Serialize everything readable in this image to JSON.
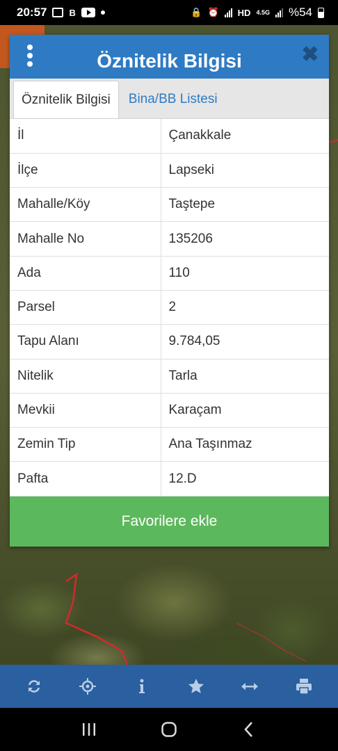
{
  "status_bar": {
    "time": "20:57",
    "app_badge": "B",
    "network": "4.5G",
    "battery": "%54"
  },
  "dialog": {
    "title": "Öznitelik Bilgisi",
    "tabs": [
      {
        "label": "Öznitelik Bilgisi",
        "active": true
      },
      {
        "label": "Bina/BB Listesi",
        "active": false
      }
    ],
    "rows": [
      {
        "key": "İl",
        "value": "Çanakkale"
      },
      {
        "key": "İlçe",
        "value": "Lapseki"
      },
      {
        "key": "Mahalle/Köy",
        "value": "Taştepe"
      },
      {
        "key": "Mahalle No",
        "value": "135206"
      },
      {
        "key": "Ada",
        "value": "110"
      },
      {
        "key": "Parsel",
        "value": "2"
      },
      {
        "key": "Tapu Alanı",
        "value": "9.784,05"
      },
      {
        "key": "Nitelik",
        "value": "Tarla"
      },
      {
        "key": "Mevkii",
        "value": "Karaçam"
      },
      {
        "key": "Zemin Tip",
        "value": "Ana Taşınmaz"
      },
      {
        "key": "Pafta",
        "value": "12.D"
      }
    ],
    "favorite_button": "Favorilere ekle"
  },
  "toolbar": {
    "icons": [
      "refresh-icon",
      "locate-icon",
      "info-icon",
      "star-icon",
      "measure-icon",
      "print-icon"
    ]
  },
  "colors": {
    "header": "#2e7bc4",
    "tab_link": "#2e7bc4",
    "favorite": "#5cb85c",
    "toolbar": "#2a5fa0",
    "parcel_line": "#d22b2b"
  }
}
